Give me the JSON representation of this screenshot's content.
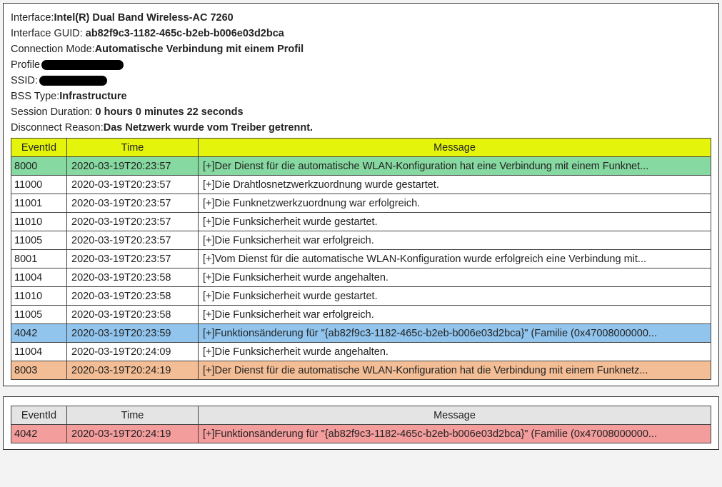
{
  "info": {
    "interface_label": "Interface:",
    "interface_value": "Intel(R) Dual Band Wireless-AC 7260",
    "guid_label": "Interface GUID: ",
    "guid_value": "ab82f9c3-1182-465c-b2eb-b006e03d2bca",
    "connmode_label": "Connection Mode:",
    "connmode_value": "Automatische Verbindung mit einem Profil",
    "profile_label": "Profile",
    "ssid_label": "SSID:",
    "bsstype_label": "BSS Type:",
    "bsstype_value": "Infrastructure",
    "duration_label": "Session Duration: ",
    "duration_value": "0 hours 0 minutes 22 seconds",
    "disconnect_label": "Disconnect Reason:",
    "disconnect_value": "Das Netzwerk wurde vom Treiber getrennt."
  },
  "headers": {
    "eventid": "EventId",
    "time": "Time",
    "message": "Message"
  },
  "table1": [
    {
      "id": "8000",
      "time": "2020-03-19T20:23:57",
      "msg": "[+]Der Dienst für die automatische WLAN-Konfiguration hat eine Verbindung mit einem Funknet...",
      "cls": "row-green"
    },
    {
      "id": "11000",
      "time": "2020-03-19T20:23:57",
      "msg": "[+]Die Drahtlosnetzwerkzuordnung wurde gestartet.",
      "cls": "row-white"
    },
    {
      "id": "11001",
      "time": "2020-03-19T20:23:57",
      "msg": "[+]Die Funknetzwerkzuordnung war erfolgreich.",
      "cls": "row-white"
    },
    {
      "id": "11010",
      "time": "2020-03-19T20:23:57",
      "msg": "[+]Die Funksicherheit wurde gestartet.",
      "cls": "row-white"
    },
    {
      "id": "11005",
      "time": "2020-03-19T20:23:57",
      "msg": "[+]Die Funksicherheit war erfolgreich.",
      "cls": "row-white"
    },
    {
      "id": "8001",
      "time": "2020-03-19T20:23:57",
      "msg": "[+]Vom Dienst für die automatische WLAN-Konfiguration wurde erfolgreich eine Verbindung mit...",
      "cls": "row-white"
    },
    {
      "id": "11004",
      "time": "2020-03-19T20:23:58",
      "msg": "[+]Die Funksicherheit wurde angehalten.",
      "cls": "row-white"
    },
    {
      "id": "11010",
      "time": "2020-03-19T20:23:58",
      "msg": "[+]Die Funksicherheit wurde gestartet.",
      "cls": "row-white"
    },
    {
      "id": "11005",
      "time": "2020-03-19T20:23:58",
      "msg": "[+]Die Funksicherheit war erfolgreich.",
      "cls": "row-white"
    },
    {
      "id": "4042",
      "time": "2020-03-19T20:23:59",
      "msg": "[+]Funktionsänderung für \"{ab82f9c3-1182-465c-b2eb-b006e03d2bca}\" (Familie (0x47008000000...",
      "cls": "row-blue"
    },
    {
      "id": "11004",
      "time": "2020-03-19T20:24:09",
      "msg": "[+]Die Funksicherheit wurde angehalten.",
      "cls": "row-white"
    },
    {
      "id": "8003",
      "time": "2020-03-19T20:24:19",
      "msg": "[+]Der Dienst für die automatische WLAN-Konfiguration hat die Verbindung mit einem Funknetz...",
      "cls": "row-orange"
    }
  ],
  "table2": [
    {
      "id": "4042",
      "time": "2020-03-19T20:24:19",
      "msg": "[+]Funktionsänderung für \"{ab82f9c3-1182-465c-b2eb-b006e03d2bca}\" (Familie (0x47008000000...",
      "cls": "row-red"
    }
  ]
}
